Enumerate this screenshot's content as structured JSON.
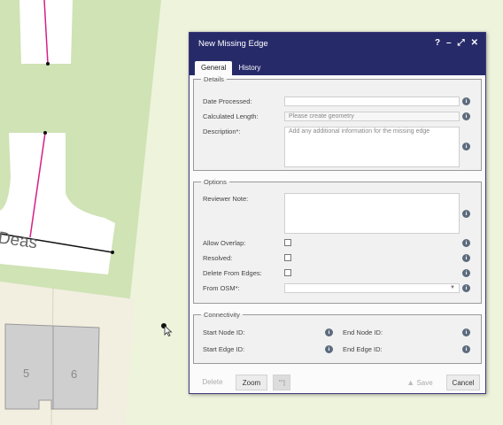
{
  "map": {
    "street_label": "Deas",
    "building_numbers": [
      "5",
      "6"
    ],
    "colors": {
      "grass": "#cfe3b5",
      "road": "#ffffff",
      "parcel": "#f2efe0",
      "building": "#cfcfcf",
      "edge_pink": "#d61f87",
      "edge_black": "#111111"
    }
  },
  "dialog": {
    "title": "New Missing Edge",
    "controls": {
      "help": "?",
      "minimize": "–",
      "maximize": "⤢",
      "close": "✕"
    },
    "tabs": [
      {
        "label": "General",
        "active": true
      },
      {
        "label": "History",
        "active": false
      }
    ],
    "details": {
      "legend": "Details",
      "date_processed": {
        "label": "Date Processed:",
        "value": ""
      },
      "calculated_length": {
        "label": "Calculated Length:",
        "placeholder": "Please create geometry"
      },
      "description": {
        "label": "Description*:",
        "placeholder": "Add any additional information for the missing edge"
      }
    },
    "options": {
      "legend": "Options",
      "reviewer_note": {
        "label": "Reviewer Note:",
        "value": ""
      },
      "allow_overlap": {
        "label": "Allow Overlap:",
        "checked": false
      },
      "resolved": {
        "label": "Resolved:",
        "checked": false
      },
      "delete_from_edges": {
        "label": "Delete From Edges:",
        "checked": false
      },
      "from_osm": {
        "label": "From OSM*:",
        "value": ""
      }
    },
    "connectivity": {
      "legend": "Connectivity",
      "start_node": "Start Node ID:",
      "end_node": "End Node ID:",
      "start_edge": "Start Edge ID:",
      "end_edge": "End Edge ID:"
    },
    "footer": {
      "delete": "Delete",
      "zoom": "Zoom",
      "save": "Save",
      "cancel": "Cancel"
    },
    "info_glyph": "i"
  }
}
